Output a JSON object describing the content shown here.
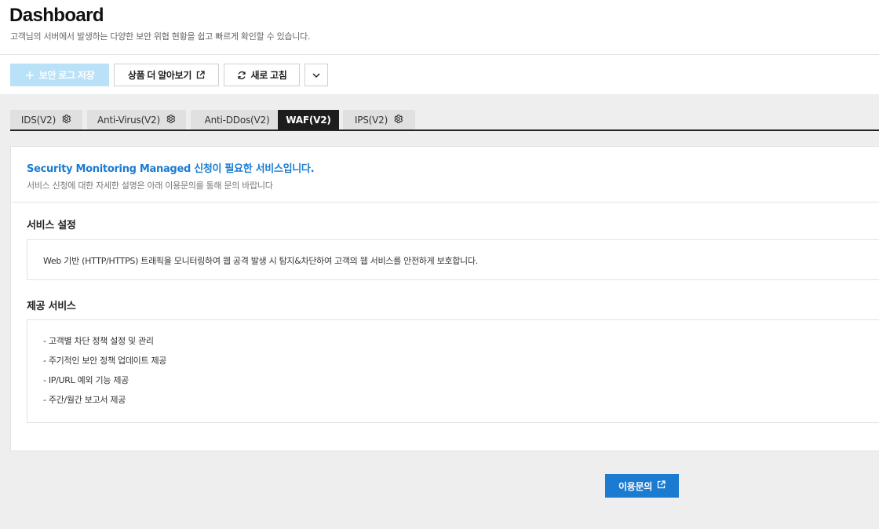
{
  "header": {
    "title": "Dashboard",
    "subtitle": "고객님의 서버에서 발생하는 다양한 보안 위협 현황을 쉽고 빠르게 확인할 수 있습니다."
  },
  "toolbar": {
    "save_label": "보안 로그 저장",
    "learn_more_label": "상품 더 알아보기",
    "refresh_label": "새로 고침"
  },
  "tabs": [
    {
      "label": "IDS(V2)",
      "icon": "gear-icon",
      "active": false
    },
    {
      "label": "Anti-Virus(V2)",
      "icon": "gear-icon",
      "active": false
    },
    {
      "label": "Anti-DDos(V2)",
      "active": false
    },
    {
      "label": "WAF(V2)",
      "active": true
    },
    {
      "label": "IPS(V2)",
      "icon": "gear-icon",
      "active": false
    }
  ],
  "notice": {
    "title": "Security Monitoring Managed 신청이 필요한 서비스입니다.",
    "description": "서비스 신청에 대한 자세한 설명은 아래 이용문의를 통해 문의 바랍니다"
  },
  "service_setting": {
    "title": "서비스 설정",
    "text": "Web 기반 (HTTP/HTTPS) 트래픽을 모니터링하여 웹 공격 발생 시 탐지&차단하여 고객의 웹 서비스를 안전하게 보호합니다."
  },
  "provided_services": {
    "title": "제공 서비스",
    "items": [
      "- 고객별 차단 정책 설정 및 관리",
      "- 주기적인 보안 정책 업데이트 제공",
      "- IP/URL 예외 기능 제공",
      "- 주간/월간 보고서 제공"
    ]
  },
  "inquiry_label": "이용문의",
  "colors": {
    "accent": "#1b7bd1",
    "save_button_disabled": "#b9e1f8",
    "active_tab": "#1d1d1d",
    "background_gray": "#eeeeee"
  }
}
